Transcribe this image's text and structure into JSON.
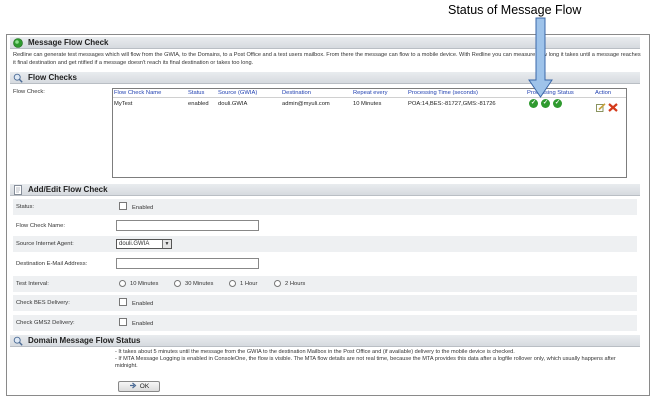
{
  "annotation": {
    "label": "Status of Message Flow"
  },
  "message_flow_check": {
    "title": "Message Flow Check",
    "description": "Redline can generate test messages which will flow from the GWIA, to the Domains, to a Post Office and a test users mailbox. From there the message can flow to a mobile device. With Redline you can measure how long it takes until a message reaches it final destination and get ntified if a message doesn't reach its final destination or takes too long."
  },
  "flow_checks": {
    "title": "Flow Checks",
    "field_label": "Flow Check:",
    "columns": [
      "Flow Check Name",
      "Status",
      "Source (GWIA)",
      "Destination",
      "Repeat every",
      "Processing Time (seconds)",
      "Processing Status",
      "Action"
    ],
    "rows": [
      {
        "name": "MyTest",
        "status": "enabled",
        "source": "douli.GWIA",
        "destination": "admin@myuli.com",
        "repeat": "10 Minutes",
        "processing_time": "POA:14,BES:-81727,GMS:-81726",
        "processing_status_icons": [
          "check-icon",
          "check-icon",
          "check-icon"
        ],
        "action_icons": [
          "edit-icon",
          "delete-icon"
        ]
      }
    ]
  },
  "add_edit": {
    "title": "Add/Edit Flow Check",
    "status_label": "Status:",
    "enabled_label": "Enabled",
    "name_label": "Flow Check Name:",
    "name_value": "",
    "source_label": "Source Internet Agent:",
    "source_value": "douli.GWIA",
    "dest_label": "Destination E-Mail Address:",
    "dest_value": "",
    "interval_label": "Test Interval:",
    "intervals": [
      "10 Minutes",
      "30 Minutes",
      "1 Hour",
      "2 Hours"
    ],
    "bes_label": "Check BES Delivery:",
    "gms_label": "Check GMS2 Delivery:"
  },
  "domain_status": {
    "title": "Domain Message Flow Status",
    "lines": [
      "- It takes about 5 minutes until the message from the GWIA to the destination Mailbox in the Post Office and (if available) delivery to the mobile device is checked.",
      "- If MTA Message Logging is enabled in ConsoleOne, the flow is visible. The MTA flow details are not real time, because the MTA provides this data after a logfile rollover only, which usually happens after midnight."
    ]
  },
  "ok_button": {
    "label": "OK"
  },
  "colors": {
    "header_link": "#1f3fb0",
    "ok_green": "#2f9a2f",
    "delete_red": "#d43a1a",
    "arrow_fill": "#9ec3ea",
    "arrow_stroke": "#3a67a8"
  }
}
